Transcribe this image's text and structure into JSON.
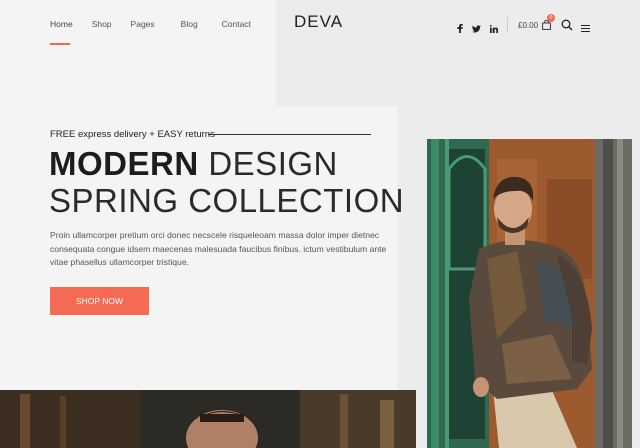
{
  "nav": {
    "items": [
      {
        "label": "Home",
        "active": true
      },
      {
        "label": "Shop"
      },
      {
        "label": "Pages"
      },
      {
        "label": "Blog"
      },
      {
        "label": "Contact"
      }
    ]
  },
  "brand": {
    "logo": "DEVA"
  },
  "header": {
    "social": [
      "f",
      "t",
      "in"
    ],
    "cart_total": "£0.00",
    "cart_count": "0",
    "accent": "#f26a55"
  },
  "hero": {
    "tagline": "FREE express delivery + EASY returns",
    "title_bold": "MODERN",
    "title_light": "DESIGN",
    "title_line2": "SPRING COLLECTION",
    "description": "Proin ullamcorper pretium orci donec necscele risqueleoam massa dolor imper dietnec consequata congue idsem maecenas malesuada faucibus finibus. ictum vestibulum ante vitae phasellus ullamcorper tristique.",
    "cta": "SHOP NOW"
  }
}
